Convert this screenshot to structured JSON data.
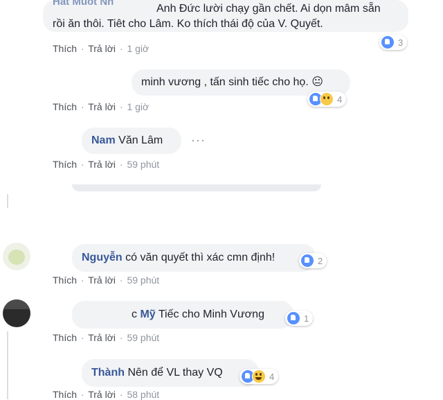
{
  "comments": [
    {
      "id": "c1",
      "author_top": "Hat Muốt Nh",
      "text_line1": "Anh Đức lười chạy gần chết. Ai dọn mâm sẵn",
      "text_line2": "rồi ăn thôi. Tiêt cho Lâm. Ko thích thái độ của V. Quyết.",
      "like_label": "Thích",
      "reply_label": "Trả lời",
      "time": "1 giờ",
      "reactions": [
        "like-icon"
      ],
      "reaction_count": "3"
    },
    {
      "id": "c2",
      "text": "minh vương , tấn sinh tiếc cho họ. 😐",
      "like_label": "Thích",
      "reply_label": "Trả lời",
      "time": "1 giờ",
      "reactions": [
        "like-icon",
        "sad-icon"
      ],
      "reaction_count": "4"
    },
    {
      "id": "c3",
      "author": "Nam",
      "text": "Văn Lâm",
      "like_label": "Thích",
      "reply_label": "Trả lời",
      "time": "59 phút"
    },
    {
      "id": "c4",
      "author": "Nguyễn",
      "text": "có văn quyết thì xác cmn định!",
      "like_label": "Thích",
      "reply_label": "Trả lời",
      "time": "59 phút",
      "reactions": [
        "like-icon"
      ],
      "reaction_count": "2"
    },
    {
      "id": "c5",
      "author_prefix": "c",
      "author": "Mỹ",
      "text": "Tiếc cho Minh Vương",
      "like_label": "Thích",
      "reply_label": "Trả lời",
      "time": "59 phút",
      "reactions": [
        "like-icon"
      ],
      "reaction_count": "1"
    },
    {
      "id": "c6",
      "author": "Thành",
      "text": "Nên để VL thay VQ",
      "like_label": "Thích",
      "reply_label": "Trả lời",
      "time": "58 phút",
      "reactions": [
        "like-icon",
        "haha-icon"
      ],
      "reaction_count": "4"
    }
  ],
  "separator": "·",
  "more_icon": "more-options-icon",
  "colors": {
    "bubble": "#f2f3f5",
    "name": "#385898",
    "meta": "#90949c",
    "like": "#5890ff"
  }
}
